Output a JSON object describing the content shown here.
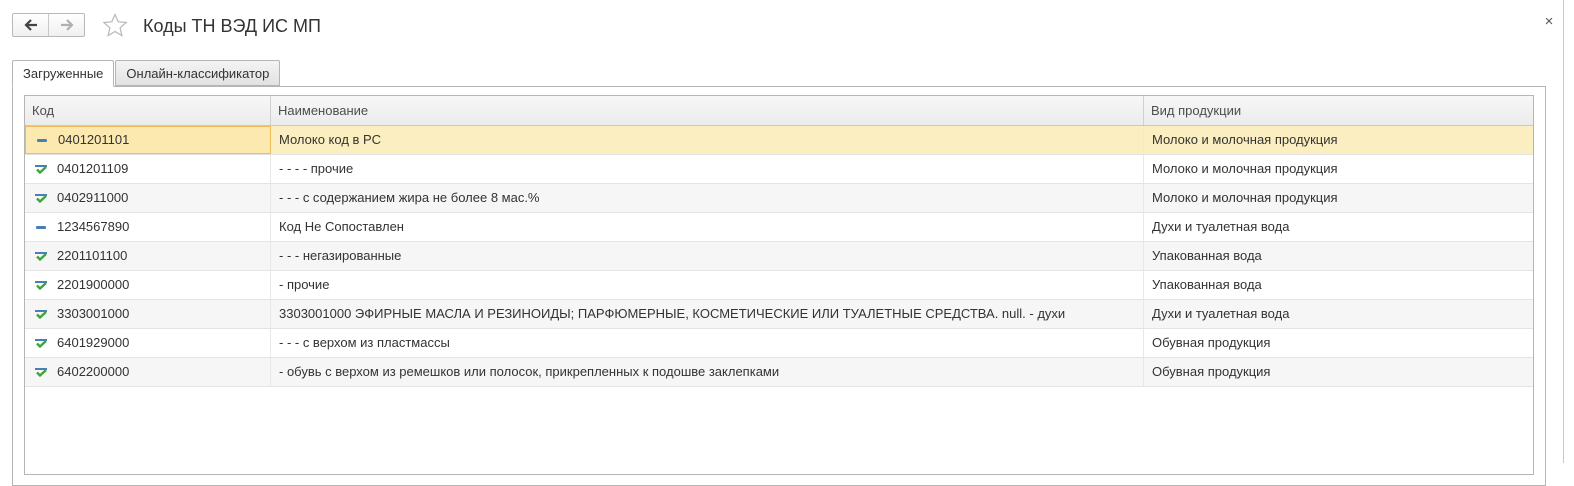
{
  "header": {
    "title": "Коды ТН ВЭД ИС МП",
    "back_icon": "arrow-left-icon",
    "forward_icon": "arrow-right-icon",
    "favorite_icon": "star-icon",
    "close_label": "×"
  },
  "tabs": [
    {
      "label": "Загруженные",
      "active": true
    },
    {
      "label": "Онлайн-классификатор",
      "active": false
    }
  ],
  "table": {
    "columns": {
      "code": "Код",
      "name": "Наименование",
      "type": "Вид продукции"
    },
    "rows": [
      {
        "status": "unmatched",
        "code": "0401201101",
        "name": "Молоко код в РС",
        "type": "Молоко и молочная продукция"
      },
      {
        "status": "matched",
        "code": "0401201109",
        "name": "- - - - прочие",
        "type": "Молоко и молочная продукция"
      },
      {
        "status": "matched",
        "code": "0402911000",
        "name": "- - - с содержанием жира не более 8 мас.%",
        "type": "Молоко и молочная продукция"
      },
      {
        "status": "unmatched",
        "code": "1234567890",
        "name": "Код Не Сопоставлен",
        "type": "Духи и туалетная вода"
      },
      {
        "status": "matched",
        "code": "2201101100",
        "name": "- - - негазированные",
        "type": "Упакованная вода"
      },
      {
        "status": "matched",
        "code": "2201900000",
        "name": "- прочие",
        "type": "Упакованная вода"
      },
      {
        "status": "matched",
        "code": "3303001000",
        "name": "3303001000 ЭФИРНЫЕ МАСЛА И РЕЗИНОИДЫ; ПАРФЮМЕРНЫЕ, КОСМЕТИЧЕСКИЕ ИЛИ ТУАЛЕТНЫЕ СРЕДСТВА. null. - духи",
        "type": "Духи и туалетная вода"
      },
      {
        "status": "matched",
        "code": "6401929000",
        "name": "- - - с верхом из пластмассы",
        "type": "Обувная продукция"
      },
      {
        "status": "matched",
        "code": "6402200000",
        "name": "- обувь с верхом из ремешков или полосок, прикрепленных к подошве заклепками",
        "type": "Обувная продукция"
      }
    ],
    "selected_index": 0
  },
  "colors": {
    "selection": "#fbefc1",
    "selection_border": "#f0b95a",
    "check_green": "#3aa63a",
    "check_blue": "#4a7fb5"
  }
}
